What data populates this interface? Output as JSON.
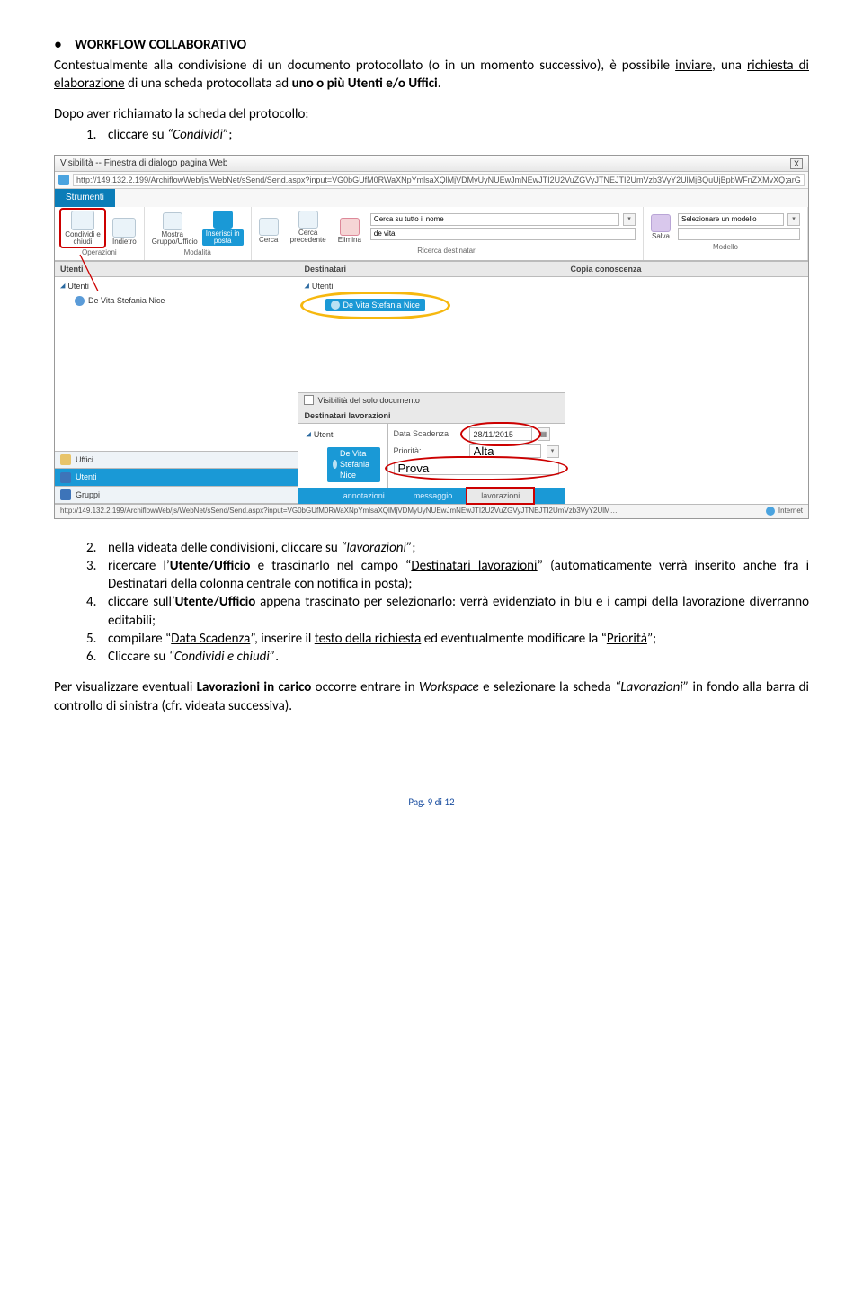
{
  "heading": "WORKFLOW COLLABORATIVO",
  "intro": {
    "p1a": "Contestualmente alla condivisione di un documento protocollato (o in un momento successivo), è possibile ",
    "p1b": "inviare",
    "p1c": ", una ",
    "p1d": "richiesta di elaborazione",
    "p1e": " di una scheda protocollata ad ",
    "p1f": "uno o più Utenti e/o Uffici",
    "p1g": "."
  },
  "instr_lead": "Dopo aver richiamato la scheda del protocollo:",
  "ol1": {
    "num": "1.",
    "a": "cliccare su ",
    "b": "“Condividi”",
    "c": ";"
  },
  "shot": {
    "title": "Visibilità -- Finestra di dialogo pagina Web",
    "close": "X",
    "url": "http://149.132.2.199/ArchiflowWeb/js/WebNet/sSend/Send.aspx?input=VG0bGUfM0RWaXNpYmlsaXQlMjVDMyUyNUEwJmNEwJTI2U2VuZGVyJTNEJTI2UmVzb3VyY2UlMjBQuUjBpbWFnZXMvXQ;arGImbG93L1MuZ2lmJTJDQ29uZGl2aXNpb25l",
    "tab": "Strumenti",
    "groups": {
      "operazioni": {
        "condividi": "Condividi e chiudi",
        "indietro": "Indietro",
        "label": "Operazioni"
      },
      "modalita": {
        "mostra": "Mostra Gruppo/Ufficio",
        "inserisci": "Inserisci in posta",
        "label": "Modalità"
      },
      "ricerca": {
        "cerca": "Cerca",
        "cercaprec": "Cerca precedente",
        "elimina": "Elimina",
        "label_search": "Cerca su tutto il nome",
        "value_search": "de vita",
        "label": "Ricerca destinatari"
      },
      "modello": {
        "salva": "Salva",
        "selmodel": "Selezionare un modello",
        "label": "Modello"
      }
    },
    "col_headers": {
      "utenti": "Utenti",
      "dest": "Destinatari",
      "cc": "Copia conoscenza"
    },
    "utenti_root": "Utenti",
    "utente_item": "De Vita Stefania Nice",
    "dest_root": "Utenti",
    "dest_chip": "De Vita Stefania Nice",
    "vis_only": "Visibilità del solo documento",
    "dest_lav_hd": "Destinatari lavorazioni",
    "dest_lav_root": "Utenti",
    "dest_lav_chip": "De Vita Stefania Nice",
    "data_scad_lbl": "Data Scadenza",
    "data_scad_val": "28/11/2015",
    "prio_lbl": "Priorità:",
    "prio_val": "Alta",
    "prova_val": "Prova",
    "side": {
      "uffici": "Uffici",
      "utenti": "Utenti",
      "gruppi": "Gruppi"
    },
    "btabs": {
      "ann": "annotazioni",
      "msg": "messaggio",
      "lav": "lavorazioni"
    },
    "status_url": "http://149.132.2.199/ArchiflowWeb/js/WebNet/sSend/Send.aspx?input=VG0bGUfM0RWaXNpYmlsaXQlMjVDMyUyNUEwJmNEwJTI2U2VuZGVyJTNEJTI2UmVzb3VyY2UlMjBQuUjBpbWFnZXMvXQ",
    "status_net": "Internet"
  },
  "ol2": {
    "num": "2.",
    "a": "nella videata delle condivisioni, cliccare su ",
    "b": "“lavorazioni”",
    "c": ";"
  },
  "ol3": {
    "num": "3.",
    "a": "ricercare l’",
    "b": "Utente/Ufficio",
    "c": " e trascinarlo nel campo “",
    "d": "Destinatari lavorazioni",
    "e": "” (automaticamente verrà inserito anche fra i Destinatari della colonna centrale con notifica in posta);"
  },
  "ol4": {
    "num": "4.",
    "a": "cliccare sull’",
    "b": "Utente/Ufficio",
    "c": " appena trascinato per selezionarlo: verrà evidenziato in blu e i campi della lavorazione diverranno editabili;"
  },
  "ol5": {
    "num": "5.",
    "a": "compilare “",
    "b": "Data Scadenza",
    "c": "”, inserire il ",
    "d": "testo della richiesta",
    "e": " ed eventualmente modificare la “",
    "f": "Priorità",
    "g": "”;"
  },
  "ol6": {
    "num": "6.",
    "a": "Cliccare su ",
    "b": "“Condividi e chiudi”",
    "c": "."
  },
  "closing": {
    "a": "Per visualizzare eventuali ",
    "b": "Lavorazioni in carico",
    "c": " occorre entrare in ",
    "d": "Workspace",
    "e": " e selezionare la scheda ",
    "f": "“Lavorazioni”",
    "g": " in fondo alla barra di controllo di sinistra (cfr. videata successiva)."
  },
  "footer": "Pag. 9 di 12"
}
